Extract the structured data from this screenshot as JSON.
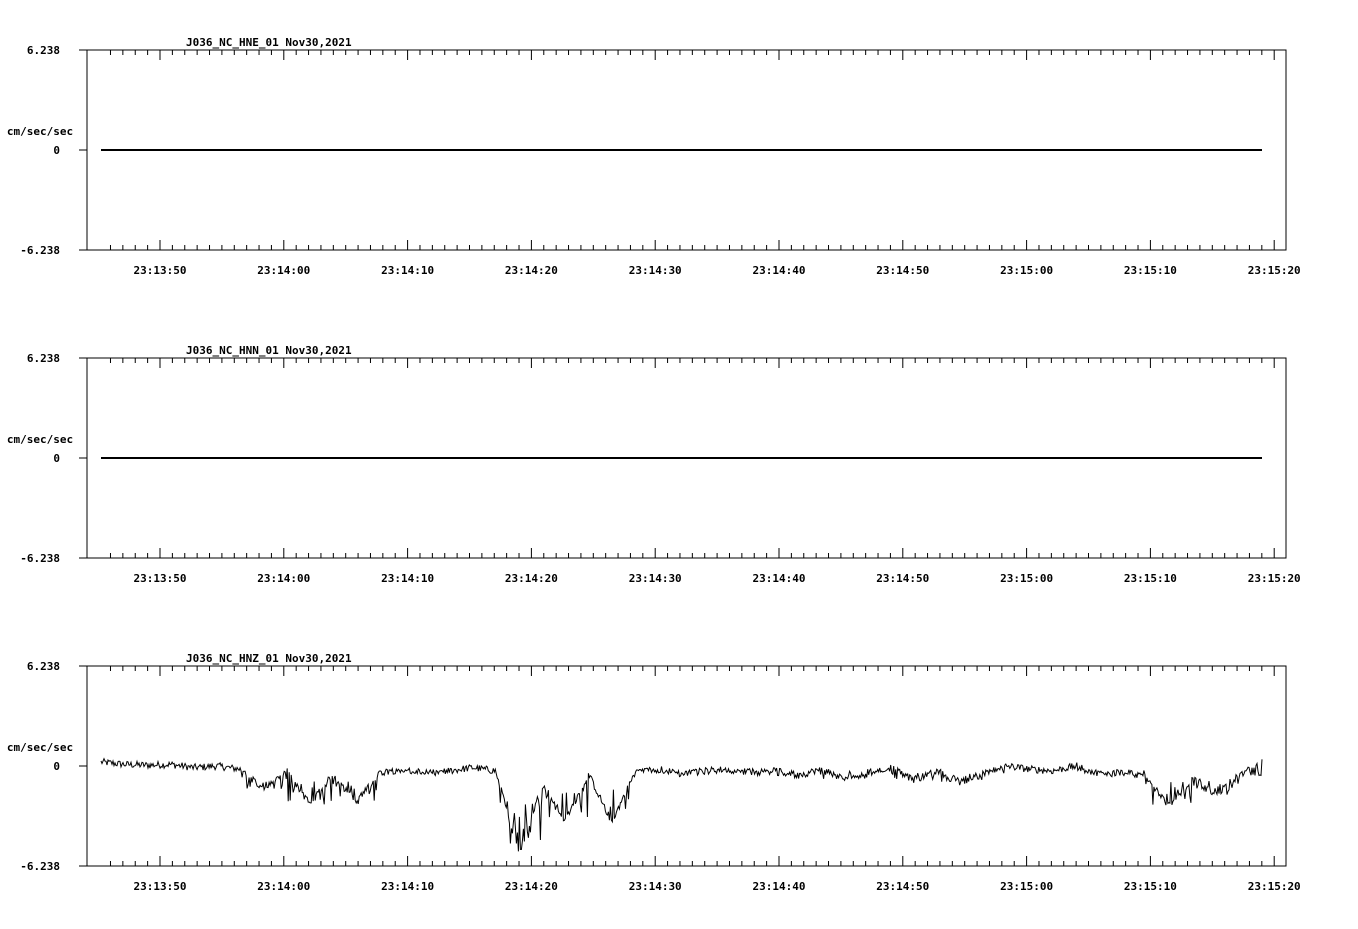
{
  "chart_data": [
    {
      "type": "line",
      "title": "J036_NC_HNE_01   Nov30,2021",
      "ylabel": "cm/sec/sec",
      "ylim": [
        -6.238,
        6.238
      ],
      "y_ticks": [
        "6.238",
        "0",
        "-6.238"
      ],
      "x_ticks": [
        "23:13:50",
        "23:14:00",
        "23:14:10",
        "23:14:20",
        "23:14:30",
        "23:14:40",
        "23:14:50",
        "23:15:00",
        "23:15:10",
        "23:15:20"
      ],
      "x_start": "23:13:45.5",
      "x_end": "23:15:19.2",
      "series": [
        {
          "values": [
            0,
            0,
            0,
            0,
            0,
            0,
            0,
            0,
            0,
            0,
            0
          ]
        }
      ]
    },
    {
      "type": "line",
      "title": "J036_NC_HNN_01   Nov30,2021",
      "ylabel": "cm/sec/sec",
      "ylim": [
        -6.238,
        6.238
      ],
      "y_ticks": [
        "6.238",
        "0",
        "-6.238"
      ],
      "x_ticks": [
        "23:13:50",
        "23:14:00",
        "23:14:10",
        "23:14:20",
        "23:14:30",
        "23:14:40",
        "23:14:50",
        "23:15:00",
        "23:15:10",
        "23:15:20"
      ],
      "x_start": "23:13:45.5",
      "x_end": "23:15:19.2",
      "series": [
        {
          "values": [
            0,
            0,
            0,
            0,
            0,
            0,
            0,
            0,
            0,
            0,
            0
          ]
        }
      ]
    },
    {
      "type": "line",
      "title": "J036_NC_HNZ_01   Nov30,2021",
      "ylabel": "cm/sec/sec",
      "ylim": [
        -6.238,
        6.238
      ],
      "y_ticks": [
        "6.238",
        "0",
        "-6.238"
      ],
      "x_ticks": [
        "23:13:50",
        "23:14:00",
        "23:14:10",
        "23:14:20",
        "23:14:30",
        "23:14:40",
        "23:14:50",
        "23:15:00",
        "23:15:10",
        "23:15:20"
      ],
      "x_start": "23:13:45.5",
      "x_end": "23:15:19.2",
      "series": [
        {
          "values": [
            0.25,
            0.1,
            0.05,
            0.1,
            -0.1,
            0.0,
            -0.2,
            -1.5,
            -0.3,
            -2.4,
            -0.5,
            -2.3,
            -0.4,
            -0.2,
            -0.5,
            -0.3,
            -0.1,
            -0.3,
            -5.5,
            -1.2,
            -3.4,
            -0.5,
            -3.5,
            -0.4,
            -0.2,
            -0.5,
            -0.3,
            -0.2,
            -0.4,
            -0.3,
            -0.6,
            -0.2,
            -0.8,
            -0.4,
            -0.1,
            -0.9,
            -0.3,
            -1.0,
            -0.5,
            0.0,
            -0.2,
            -0.3,
            0.0,
            -0.5,
            -0.4,
            -0.6,
            -2.5,
            -0.8,
            -1.8,
            -0.6,
            0.2
          ]
        }
      ]
    }
  ]
}
